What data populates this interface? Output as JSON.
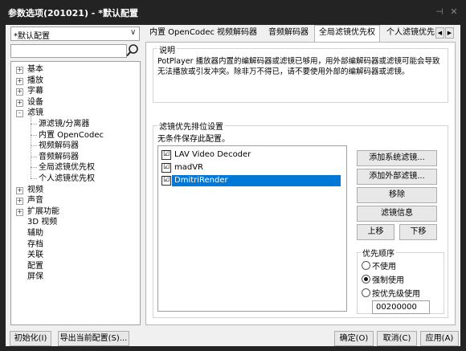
{
  "window": {
    "title": "参数选项(201021) - *默认配置",
    "pin_glyph": "⊣",
    "close_glyph": "✕"
  },
  "left": {
    "profile_select": "*默认配置",
    "search_value": "",
    "tree": [
      {
        "label": "基本",
        "expander": "+"
      },
      {
        "label": "播放",
        "expander": "+"
      },
      {
        "label": "字幕",
        "expander": "+"
      },
      {
        "label": "设备",
        "expander": "+"
      },
      {
        "label": "滤镜",
        "expander": "-"
      },
      {
        "label": "源滤镜/分离器"
      },
      {
        "label": "内置 OpenCodec"
      },
      {
        "label": "视频解码器"
      },
      {
        "label": "音频解码器"
      },
      {
        "label": "全局滤镜优先权"
      },
      {
        "label": "个人滤镜优先权"
      },
      {
        "label": "视频",
        "expander": "+"
      },
      {
        "label": "声音",
        "expander": "+"
      },
      {
        "label": "扩展功能",
        "expander": "+"
      },
      {
        "label": "3D 视频"
      },
      {
        "label": "辅助"
      },
      {
        "label": "存档"
      },
      {
        "label": "关联"
      },
      {
        "label": "配置"
      },
      {
        "label": "屏保"
      }
    ]
  },
  "tabs": [
    {
      "label": "内置 OpenCodec"
    },
    {
      "label": "视频解码器"
    },
    {
      "label": "音频解码器"
    },
    {
      "label": "全局滤镜优先权"
    },
    {
      "label": "个人滤镜优先"
    }
  ],
  "tab_scroll": {
    "left": "◀",
    "right": "▶"
  },
  "description": {
    "legend": "说明",
    "text": "PotPlayer 播放器内置的编解码器或滤镜已够用，用外部编解码器或滤镜可能会导致无法播放或引发冲突。除非万不得已，请不要使用外部的编解码器或滤镜。"
  },
  "priority": {
    "legend": "滤镜优先排位设置",
    "note": "无条件保存此配置。",
    "filters": [
      {
        "name": "LAV Video Decoder",
        "checked": "☑"
      },
      {
        "name": "madVR",
        "checked": "☑"
      },
      {
        "name": "DmitriRender",
        "checked": "☑"
      }
    ],
    "buttons": {
      "add_system": "添加系统滤镜...",
      "add_external": "添加外部滤镜...",
      "remove": "移除",
      "filter_info": "滤镜信息",
      "up": "上移",
      "down": "下移"
    },
    "order": {
      "legend": "优先顺序",
      "options": [
        {
          "label": "不使用"
        },
        {
          "label": "强制使用"
        },
        {
          "label": "按优先级使用"
        }
      ],
      "selected_index": 1,
      "value": "00200000"
    }
  },
  "bottom": {
    "init": "初始化(I)",
    "export": "导出当前配置(S)...",
    "ok": "确定(O)",
    "cancel": "取消(C)",
    "apply": "应用(A)"
  },
  "colors": {
    "selection": "#0078d7",
    "accent_dark": "#232323"
  }
}
